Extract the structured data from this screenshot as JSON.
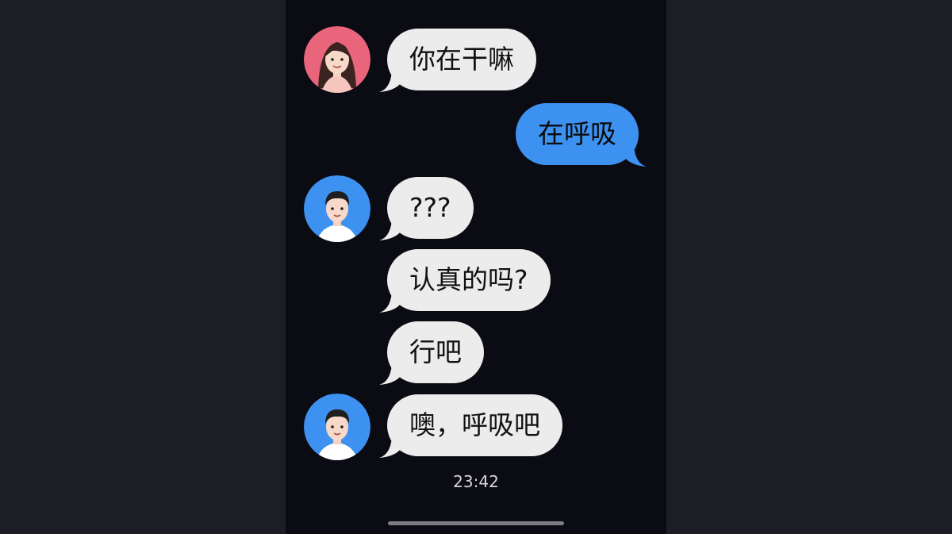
{
  "chat": {
    "messages": [
      {
        "sender": "female",
        "direction": "incoming",
        "text": "你在干嘛"
      },
      {
        "sender": "self",
        "direction": "outgoing",
        "text": "在呼吸"
      },
      {
        "sender": "male",
        "direction": "incoming",
        "text": "???"
      },
      {
        "sender": "male",
        "direction": "incoming",
        "text": "认真的吗?"
      },
      {
        "sender": "male",
        "direction": "incoming",
        "text": "行吧"
      },
      {
        "sender": "male",
        "direction": "incoming",
        "text": "噢，呼吸吧"
      }
    ],
    "timestamp": "23:42"
  },
  "colors": {
    "background": "#0b0b13",
    "incoming_bubble": "#ececec",
    "outgoing_bubble": "#3d91f0",
    "female_avatar_bg": "#e9657b",
    "male_avatar_bg": "#3d91f0"
  },
  "icons": {
    "female_avatar": "female-avatar-icon",
    "male_avatar": "male-avatar-icon"
  }
}
